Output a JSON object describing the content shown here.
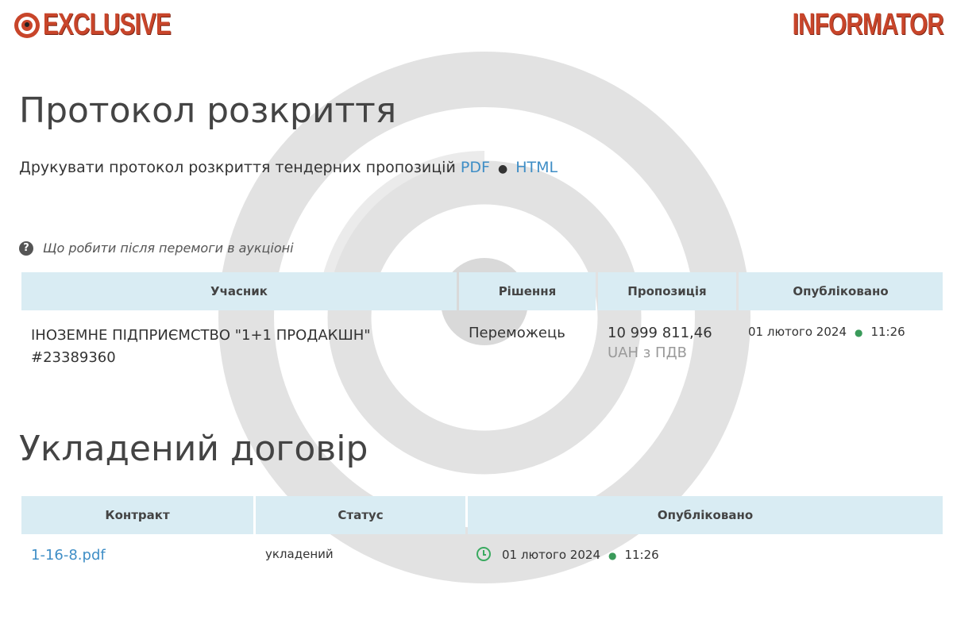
{
  "brand": {
    "left": "EXCLUSIVE",
    "right": "INFORMATOR",
    "color": "#c8452a"
  },
  "disclosure": {
    "title": "Протокол розкриття",
    "print_text": "Друкувати протокол розкриття тендерних пропозицій",
    "pdf_link": "PDF",
    "html_link": "HTML",
    "separator": "●"
  },
  "help_link": "Що робити після перемоги в аукціоні",
  "bids_table": {
    "headers": [
      "Учасник",
      "Рішення",
      "Пропозиція",
      "Опубліковано"
    ],
    "row": {
      "participant": "ІНОЗЕМНЕ ПІДПРИЄМСТВО \"1+1 ПРОДАКШН\"",
      "participant_id": "#23389360",
      "decision": "Переможець",
      "amount": "10 999 811,46",
      "currency": "UAH з ПДВ",
      "date": "01 лютого 2024",
      "time": "11:26"
    }
  },
  "contract": {
    "title": "Укладений договір",
    "headers": [
      "Контракт",
      "Статус",
      "Опубліковано"
    ],
    "row": {
      "file": "1-16-8.pdf",
      "status": "укладений",
      "date": "01 лютого 2024",
      "time": "11:26"
    }
  },
  "colors": {
    "accent_link": "#3f8ec6",
    "header_bg": "#d9ecf3",
    "clock_green": "#3aaa60"
  }
}
